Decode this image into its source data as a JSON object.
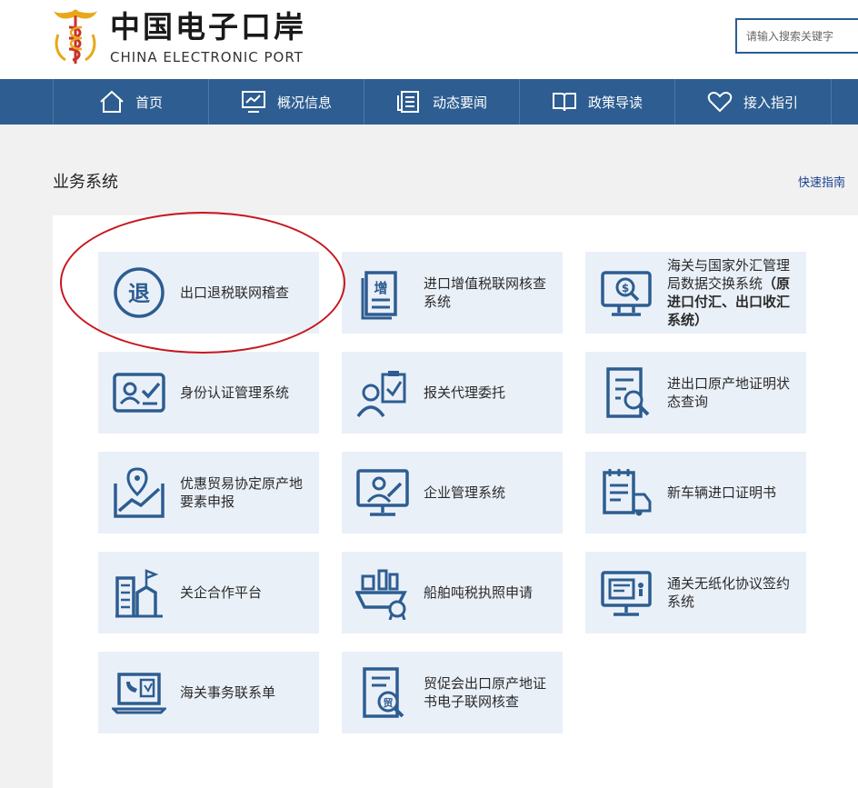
{
  "brand": {
    "name_cn": "中国电子口岸",
    "name_en": "CHINA ELECTRONIC PORT"
  },
  "search": {
    "placeholder": "请输入搜索关键字"
  },
  "nav": {
    "items": [
      {
        "label": "首页",
        "icon": "home-icon"
      },
      {
        "label": "概况信息",
        "icon": "chart-monitor-icon"
      },
      {
        "label": "动态要闻",
        "icon": "news-icon"
      },
      {
        "label": "政策导读",
        "icon": "book-icon"
      },
      {
        "label": "接入指引",
        "icon": "heart-icon"
      }
    ]
  },
  "section": {
    "title": "业务系统",
    "quick_link": "快速指南"
  },
  "services": [
    {
      "label": "出口退税联网稽查",
      "icon": "tax-refund-icon",
      "badge": "退"
    },
    {
      "label": "进口增值税联网核查系统",
      "icon": "vat-document-icon",
      "badge": "增"
    },
    {
      "label": "海关与国家外汇管理局数据交换系统",
      "label_bold": "（原进口付汇、出口收汇系统）",
      "icon": "forex-monitor-icon"
    },
    {
      "label": "身份认证管理系统",
      "icon": "id-card-icon"
    },
    {
      "label": "报关代理委托",
      "icon": "agent-clipboard-icon"
    },
    {
      "label": "进出口原产地证明状态查询",
      "icon": "document-search-icon"
    },
    {
      "label": "优惠贸易协定原产地要素申报",
      "icon": "map-trend-icon"
    },
    {
      "label": "企业管理系统",
      "icon": "presenter-monitor-icon"
    },
    {
      "label": "新车辆进口证明书",
      "icon": "vehicle-document-icon"
    },
    {
      "label": "关企合作平台",
      "icon": "building-icon"
    },
    {
      "label": "船舶吨税执照申请",
      "icon": "ship-icon"
    },
    {
      "label": "通关无纸化协议签约系统",
      "icon": "paperless-monitor-icon"
    },
    {
      "label": "海关事务联系单",
      "icon": "laptop-phone-icon"
    },
    {
      "label": "贸促会出口原产地证书电子联网核查",
      "icon": "certificate-search-icon",
      "badge": "贸"
    }
  ],
  "colors": {
    "nav": "#2d5d91",
    "card": "#eaf0f8",
    "icon": "#2d5d91",
    "highlight": "#c8161d"
  }
}
